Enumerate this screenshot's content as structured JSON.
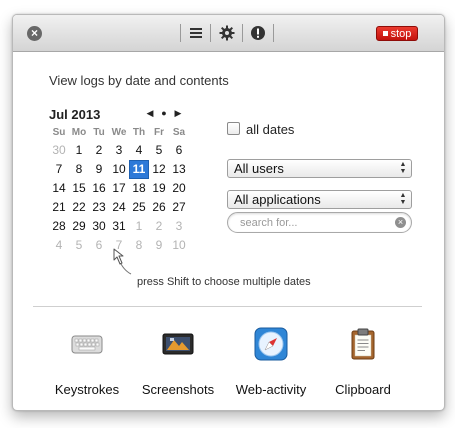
{
  "toolbar": {
    "close_icon": "close-icon",
    "icons": [
      "list-icon",
      "gear-icon",
      "alert-icon"
    ],
    "stop_label": "stop",
    "stop_color": "#d4241b"
  },
  "heading": "View logs by date and contents",
  "calendar": {
    "month_label": "Jul 2013",
    "nav": [
      "◀",
      "●",
      "▶"
    ],
    "weekdays": [
      "Su",
      "Mo",
      "Tu",
      "We",
      "Th",
      "Fr",
      "Sa"
    ],
    "weeks": [
      [
        "30",
        "1",
        "2",
        "3",
        "4",
        "5",
        "6"
      ],
      [
        "7",
        "8",
        "9",
        "10",
        "11",
        "12",
        "13"
      ],
      [
        "14",
        "15",
        "16",
        "17",
        "18",
        "19",
        "20"
      ],
      [
        "21",
        "22",
        "23",
        "24",
        "25",
        "26",
        "27"
      ],
      [
        "28",
        "29",
        "30",
        "31",
        "1",
        "2",
        "3"
      ],
      [
        "4",
        "5",
        "6",
        "7",
        "8",
        "9",
        "10"
      ]
    ],
    "selected": "11",
    "selected_color": "#2d79d8"
  },
  "filters": {
    "all_dates_label": "all dates",
    "all_dates_checked": false,
    "users_value": "All users",
    "apps_value": "All applications",
    "search_placeholder": "search for..."
  },
  "hint": "press Shift to choose multiple dates",
  "tools": [
    {
      "label": "Keystrokes",
      "icon": "keyboard-icon"
    },
    {
      "label": "Screenshots",
      "icon": "screenshots-icon"
    },
    {
      "label": "Web-activity",
      "icon": "safari-compass-icon"
    },
    {
      "label": "Clipboard",
      "icon": "clipboard-icon"
    }
  ]
}
